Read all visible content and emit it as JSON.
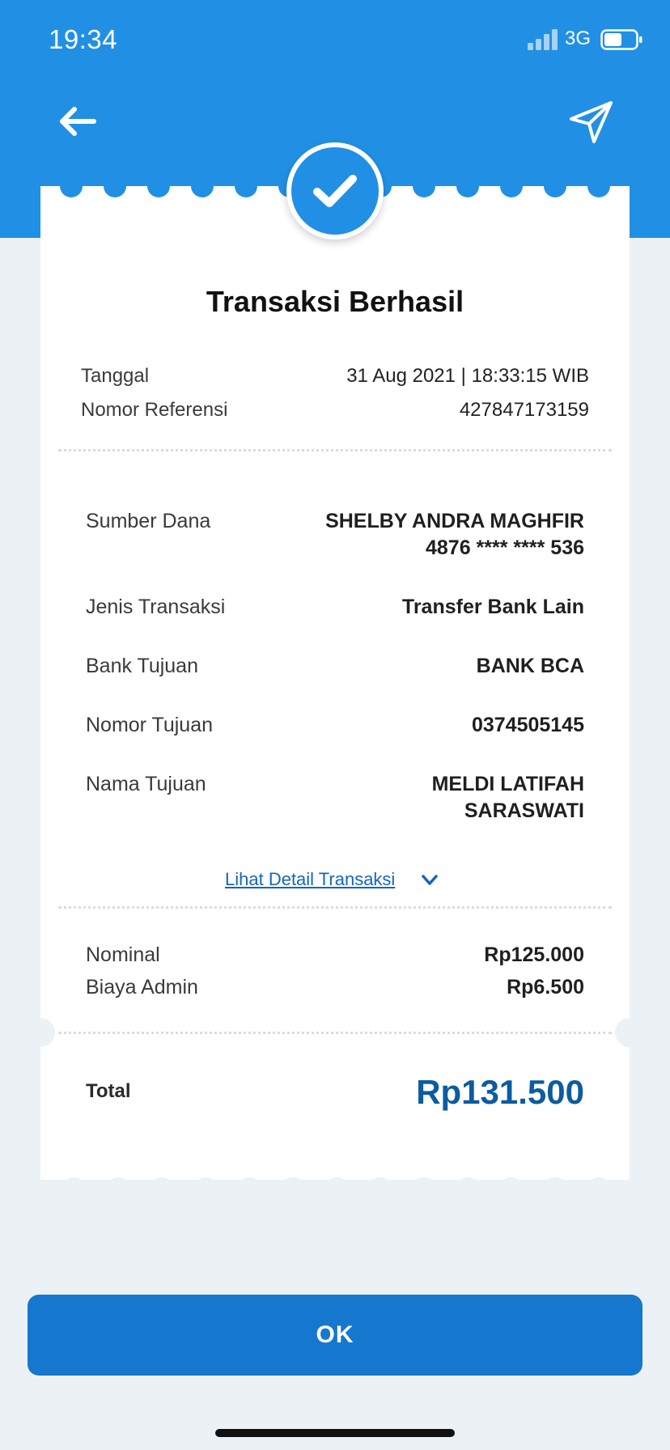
{
  "status_bar": {
    "time": "19:34",
    "network": "3G"
  },
  "receipt": {
    "title": "Transaksi Berhasil",
    "meta": [
      {
        "label": "Tanggal",
        "value": "31 Aug 2021 | 18:33:15 WIB"
      },
      {
        "label": "Nomor Referensi",
        "value": "427847173159"
      }
    ],
    "details": {
      "sumber_dana": {
        "label": "Sumber Dana",
        "value_line1": "SHELBY ANDRA MAGHFIR",
        "value_line2": "4876 **** **** 536"
      },
      "jenis_transaksi": {
        "label": "Jenis Transaksi",
        "value": "Transfer Bank Lain"
      },
      "bank_tujuan": {
        "label": "Bank Tujuan",
        "value": "BANK BCA"
      },
      "nomor_tujuan": {
        "label": "Nomor Tujuan",
        "value": "0374505145"
      },
      "nama_tujuan": {
        "label": "Nama Tujuan",
        "value_line1": "MELDI LATIFAH",
        "value_line2": "SARASWATI"
      }
    },
    "detail_link": "Lihat Detail Transaksi",
    "amounts": [
      {
        "label": "Nominal",
        "value": "Rp125.000"
      },
      {
        "label": "Biaya Admin",
        "value": "Rp6.500"
      }
    ],
    "total": {
      "label": "Total",
      "value": "Rp131.500"
    }
  },
  "ok_button": "OK",
  "colors": {
    "primary": "#2190E4",
    "button": "#1677CE",
    "total": "#0D5BA1",
    "background": "#ECF1F5"
  }
}
